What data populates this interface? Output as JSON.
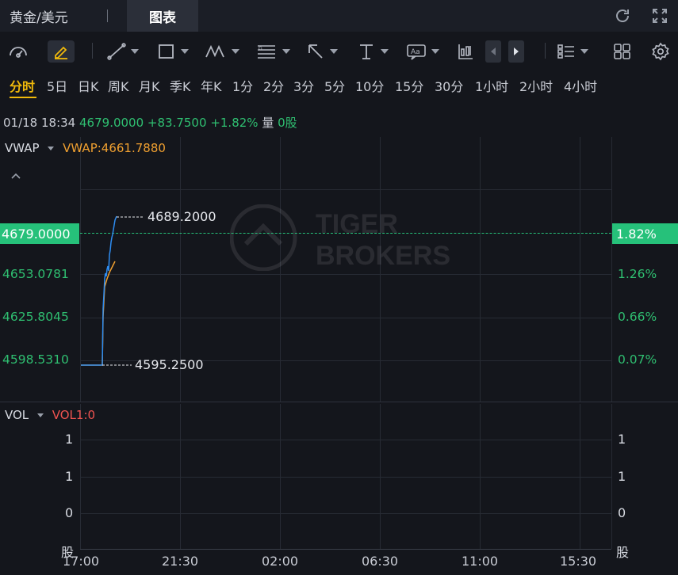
{
  "header": {
    "symbol": "黄金/美元",
    "active_tab": "图表"
  },
  "toolbar": {
    "tools": [
      "gauge-tool",
      "draw-tool",
      "line-tool",
      "rectangle-tool",
      "pattern-tool",
      "fib-tool",
      "arrow-tool",
      "vertical-line-tool",
      "text-tool",
      "indicator-tool"
    ],
    "layout_icon": "grid-layout-icon",
    "settings_icon": "gear-icon"
  },
  "periods": {
    "items": [
      "分时",
      "5日",
      "日K",
      "周K",
      "月K",
      "季K",
      "年K",
      "1分",
      "2分",
      "3分",
      "5分",
      "10分",
      "15分",
      "30分",
      "1小时",
      "2小时",
      "4小时"
    ],
    "active": "分时"
  },
  "info": {
    "datetime": "01/18 18:34",
    "price": "4679.0000",
    "change": "+83.7500",
    "change_pct": "+1.82%",
    "volume_label": "量",
    "volume": "0股"
  },
  "main_chart": {
    "indicator": "VWAP",
    "indicator_value": "VWAP:4661.7880",
    "current_price_tag": "4679.0000",
    "current_pct_tag": "1.82%",
    "left_axis": [
      "4653.0781",
      "4625.8045",
      "4598.5310"
    ],
    "right_axis": [
      "1.26%",
      "0.66%",
      "0.07%"
    ],
    "high_label": "4689.2000",
    "low_label": "4595.2500",
    "watermark": "TIGER BROKERS"
  },
  "volume_chart": {
    "indicator": "VOL",
    "indicator_value": "VOL1:0",
    "left_axis": [
      "1",
      "1",
      "0",
      "股"
    ],
    "right_axis": [
      "1",
      "1",
      "0",
      "股"
    ]
  },
  "x_axis": [
    "17:00",
    "21:30",
    "02:00",
    "06:30",
    "11:00",
    "15:30"
  ],
  "colors": {
    "up": "#2fbf71",
    "accent": "#f0b90b",
    "vwap": "#f0a030",
    "price_line": "#2e8cf0",
    "vol_label": "#ef5350",
    "background": "#14161c"
  }
}
